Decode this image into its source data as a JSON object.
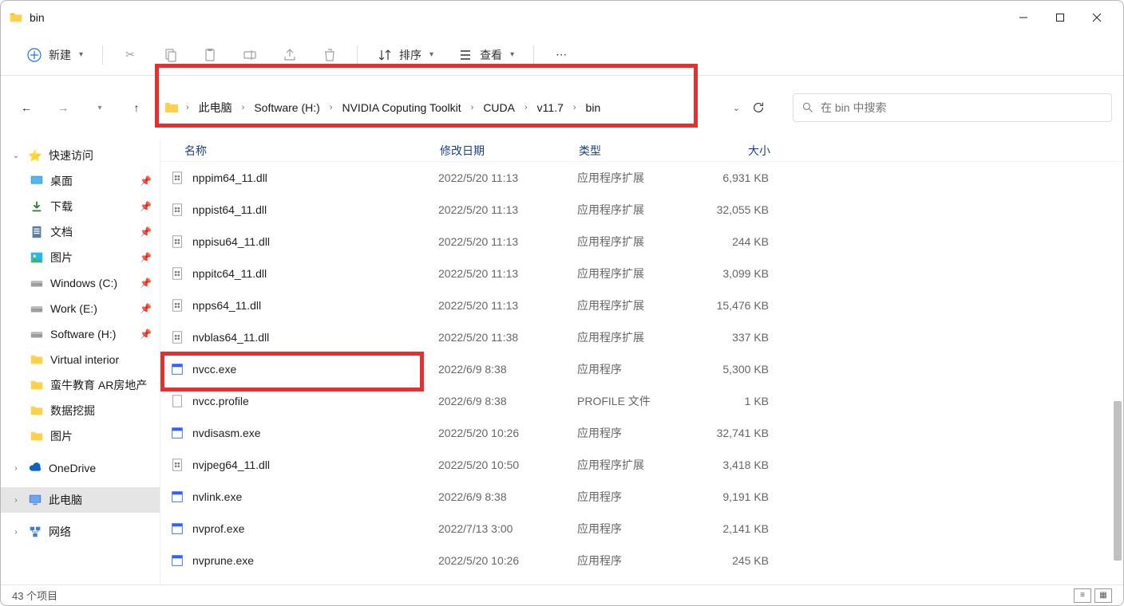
{
  "window": {
    "title": "bin"
  },
  "toolbar": {
    "new_label": "新建",
    "sort_label": "排序",
    "view_label": "查看"
  },
  "breadcrumb": {
    "segments": [
      "此电脑",
      "Software (H:)",
      "NVIDIA Coputing Toolkit",
      "CUDA",
      "v11.7",
      "bin"
    ]
  },
  "search": {
    "placeholder": "在 bin 中搜索"
  },
  "sidebar": {
    "quick": "快速访问",
    "quick_items": [
      {
        "label": "桌面",
        "icon": "desktop",
        "pin": true
      },
      {
        "label": "下载",
        "icon": "download",
        "pin": true
      },
      {
        "label": "文档",
        "icon": "doc",
        "pin": true
      },
      {
        "label": "图片",
        "icon": "picture",
        "pin": true
      },
      {
        "label": "Windows (C:)",
        "icon": "drive",
        "pin": true
      },
      {
        "label": "Work (E:)",
        "icon": "drive",
        "pin": true
      },
      {
        "label": "Software (H:)",
        "icon": "drive",
        "pin": true
      },
      {
        "label": "Virtual interior",
        "icon": "folder",
        "pin": false
      },
      {
        "label": "蛮牛教育 AR房地产",
        "icon": "folder",
        "pin": false
      },
      {
        "label": "数据挖掘",
        "icon": "folder",
        "pin": false
      },
      {
        "label": "图片",
        "icon": "folder",
        "pin": false
      }
    ],
    "onedrive": "OneDrive",
    "thispc": "此电脑",
    "network": "网络"
  },
  "columns": {
    "name": "名称",
    "date": "修改日期",
    "type": "类型",
    "size": "大小"
  },
  "files": [
    {
      "name": "nppim64_11.dll",
      "date": "2022/5/20 11:13",
      "type": "应用程序扩展",
      "size": "6,931 KB",
      "icon": "dll"
    },
    {
      "name": "nppist64_11.dll",
      "date": "2022/5/20 11:13",
      "type": "应用程序扩展",
      "size": "32,055 KB",
      "icon": "dll"
    },
    {
      "name": "nppisu64_11.dll",
      "date": "2022/5/20 11:13",
      "type": "应用程序扩展",
      "size": "244 KB",
      "icon": "dll"
    },
    {
      "name": "nppitc64_11.dll",
      "date": "2022/5/20 11:13",
      "type": "应用程序扩展",
      "size": "3,099 KB",
      "icon": "dll"
    },
    {
      "name": "npps64_11.dll",
      "date": "2022/5/20 11:13",
      "type": "应用程序扩展",
      "size": "15,476 KB",
      "icon": "dll"
    },
    {
      "name": "nvblas64_11.dll",
      "date": "2022/5/20 11:38",
      "type": "应用程序扩展",
      "size": "337 KB",
      "icon": "dll"
    },
    {
      "name": "nvcc.exe",
      "date": "2022/6/9 8:38",
      "type": "应用程序",
      "size": "5,300 KB",
      "icon": "exe"
    },
    {
      "name": "nvcc.profile",
      "date": "2022/6/9 8:38",
      "type": "PROFILE 文件",
      "size": "1 KB",
      "icon": "file"
    },
    {
      "name": "nvdisasm.exe",
      "date": "2022/5/20 10:26",
      "type": "应用程序",
      "size": "32,741 KB",
      "icon": "exe"
    },
    {
      "name": "nvjpeg64_11.dll",
      "date": "2022/5/20 10:50",
      "type": "应用程序扩展",
      "size": "3,418 KB",
      "icon": "dll"
    },
    {
      "name": "nvlink.exe",
      "date": "2022/6/9 8:38",
      "type": "应用程序",
      "size": "9,191 KB",
      "icon": "exe"
    },
    {
      "name": "nvprof.exe",
      "date": "2022/7/13 3:00",
      "type": "应用程序",
      "size": "2,141 KB",
      "icon": "exe"
    },
    {
      "name": "nvprune.exe",
      "date": "2022/5/20 10:26",
      "type": "应用程序",
      "size": "245 KB",
      "icon": "exe"
    }
  ],
  "status": {
    "count": "43 个项目"
  }
}
